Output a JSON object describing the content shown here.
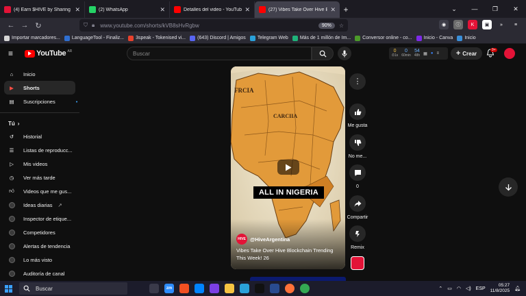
{
  "browser": {
    "tabs": [
      {
        "title": "(4) Earn $HIVE by Sharing Conte",
        "icon": "hive-icon",
        "color": "#e31337",
        "active": false
      },
      {
        "title": "(2) WhatsApp",
        "icon": "whatsapp-icon",
        "color": "#25d366",
        "active": false
      },
      {
        "title": "Detalles del video - YouTube Stu",
        "icon": "youtube-studio-icon",
        "color": "#ff0000",
        "active": false
      },
      {
        "title": "(27) Vibes Take Over Hive Block",
        "icon": "youtube-icon",
        "color": "#ff0000",
        "active": true
      }
    ],
    "url_text": "www.youtube.com/shorts/kVB8sHvRgbw",
    "zoom_label": "90%",
    "bookmarks": [
      {
        "label": "Importar marcadores...",
        "color": "#d6d6d6"
      },
      {
        "label": "LanguageTool - Finaliz...",
        "color": "#2f6fd1"
      },
      {
        "label": "3speak - Tokenised vi...",
        "color": "#e8412c"
      },
      {
        "label": "(643) Discord | Amigos",
        "color": "#5865f2"
      },
      {
        "label": "Telegram Web",
        "color": "#2aa1da"
      },
      {
        "label": "Más de 1 millón de Im...",
        "color": "#1fb37a"
      },
      {
        "label": "Conversor online - co...",
        "color": "#4c9a2a"
      },
      {
        "label": "Inicio - Canva",
        "color": "#7d2ae8"
      },
      {
        "label": "Inicio",
        "color": "#3a8fd9"
      }
    ]
  },
  "youtube": {
    "logo_text": "YouTube",
    "country_code": "AR",
    "search_placeholder": "Buscar",
    "create_label": "Crear",
    "notification_count": "9+",
    "hive_widget": [
      {
        "value": "0",
        "sub": "⏱1s",
        "accent": "gold"
      },
      {
        "value": "0",
        "sub": "60min",
        "accent": "blue"
      },
      {
        "value": "54",
        "sub": "48h",
        "accent": "blue"
      }
    ]
  },
  "sidebar": {
    "main": [
      {
        "label": "Inicio",
        "icon": "home-icon",
        "active": false
      },
      {
        "label": "Shorts",
        "icon": "shorts-icon",
        "active": true
      },
      {
        "label": "Suscripciones",
        "icon": "subscriptions-icon",
        "active": false
      }
    ],
    "you_heading": "Tú",
    "you_items": [
      {
        "label": "Historial",
        "icon": "history-icon"
      },
      {
        "label": "Listas de reproducc...",
        "icon": "playlists-icon"
      },
      {
        "label": "Mis videos",
        "icon": "my-videos-icon"
      },
      {
        "label": "Ver más tarde",
        "icon": "watch-later-icon"
      },
      {
        "label": "Videos que me gus...",
        "icon": "liked-icon"
      }
    ],
    "channel_items": [
      {
        "label": "Ideas diarias",
        "external": true
      },
      {
        "label": "Inspector de etique...",
        "external": false
      },
      {
        "label": "Competidores",
        "external": false
      },
      {
        "label": "Alertas de tendencia",
        "external": false
      },
      {
        "label": "Lo más visto",
        "external": false
      },
      {
        "label": "Auditoría de canal",
        "external": false
      }
    ]
  },
  "short": {
    "map_labels": {
      "region1": "FRCIA",
      "region2": "CARCIIA"
    },
    "caption": "ALL IN NIGERIA",
    "channel": "@HiveArgentina",
    "channel_avatar_text": "HIVE",
    "title": "Vibes Take Over Hive Blockchain  Trending This Week! 26",
    "actions": {
      "like_label": "Me gusta",
      "dislike_label": "No me...",
      "comments_count": "0",
      "share_label": "Compartir",
      "remix_label": "Remix"
    }
  },
  "taskbar": {
    "search_placeholder": "Buscar",
    "apps": [
      {
        "name": "task-view-icon",
        "label": "",
        "color": "#3a3a4a"
      },
      {
        "name": "zoom-icon",
        "label": "zm",
        "color": "#2d8cff"
      },
      {
        "name": "microsoft-store-icon",
        "label": "",
        "color": "#f25022"
      },
      {
        "name": "messenger-icon",
        "label": "",
        "color": "#0084ff"
      },
      {
        "name": "app-purple-icon",
        "label": "",
        "color": "#7b3fe4"
      },
      {
        "name": "file-explorer-icon",
        "label": "",
        "color": "#f6c342"
      },
      {
        "name": "telegram-icon",
        "label": "",
        "color": "#2aa1da"
      },
      {
        "name": "capcut-icon",
        "label": "",
        "color": "#111111"
      },
      {
        "name": "app-blue-icon",
        "label": "",
        "color": "#294b8f"
      },
      {
        "name": "firefox-icon",
        "label": "",
        "color": "#ff7139"
      },
      {
        "name": "chrome-icon",
        "label": "",
        "color": "#34a853"
      }
    ],
    "language": "ESP",
    "time": "05:27",
    "date": "11/8/2025"
  }
}
